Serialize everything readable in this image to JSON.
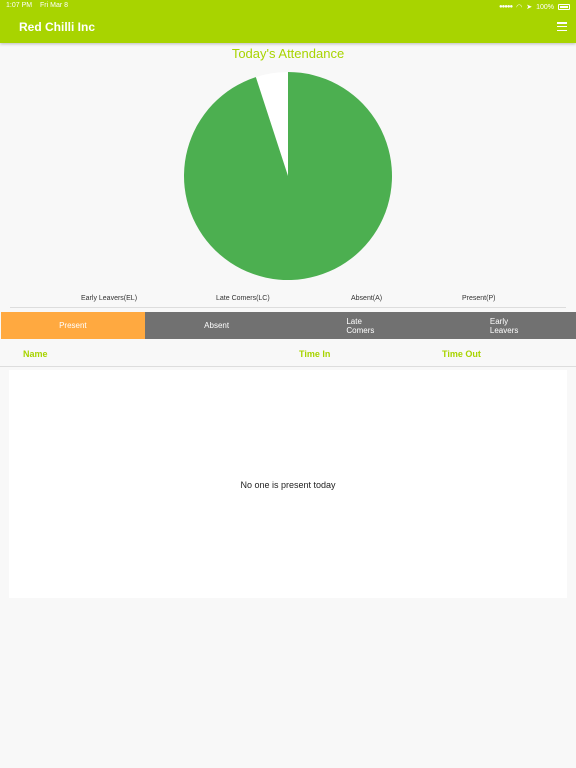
{
  "status_bar": {
    "time": "1:07 PM",
    "date": "Fri Mar 8",
    "battery": "100%",
    "icons": [
      "signal-icon",
      "wifi-icon",
      "location-icon",
      "battery-icon"
    ]
  },
  "header": {
    "title": "Red Chilli Inc",
    "menu_icon": "hamburger-menu-icon"
  },
  "colors": {
    "brand": "#a8d400",
    "pie_green": "#4caf50",
    "tab_active": "#ffa940",
    "tab_inactive": "#717171"
  },
  "chart_data": {
    "type": "pie",
    "title": "Today's Attendance",
    "categories": [
      "Early Leavers(EL)",
      "Late Comers(LC)",
      "Absent(A)",
      "Present(P)"
    ],
    "values": [
      0,
      0,
      19,
      1
    ],
    "colors": [
      "#4caf50",
      "#4caf50",
      "#4caf50",
      "#ffffff"
    ]
  },
  "tabs": [
    {
      "label": "Present",
      "active": true
    },
    {
      "label": "Absent",
      "active": false
    },
    {
      "label": "Late\nComers",
      "active": false
    },
    {
      "label": "Early\nLeavers",
      "active": false
    }
  ],
  "table": {
    "columns": [
      "Name",
      "Time In",
      "Time Out"
    ],
    "empty_message": "No one is present today"
  }
}
